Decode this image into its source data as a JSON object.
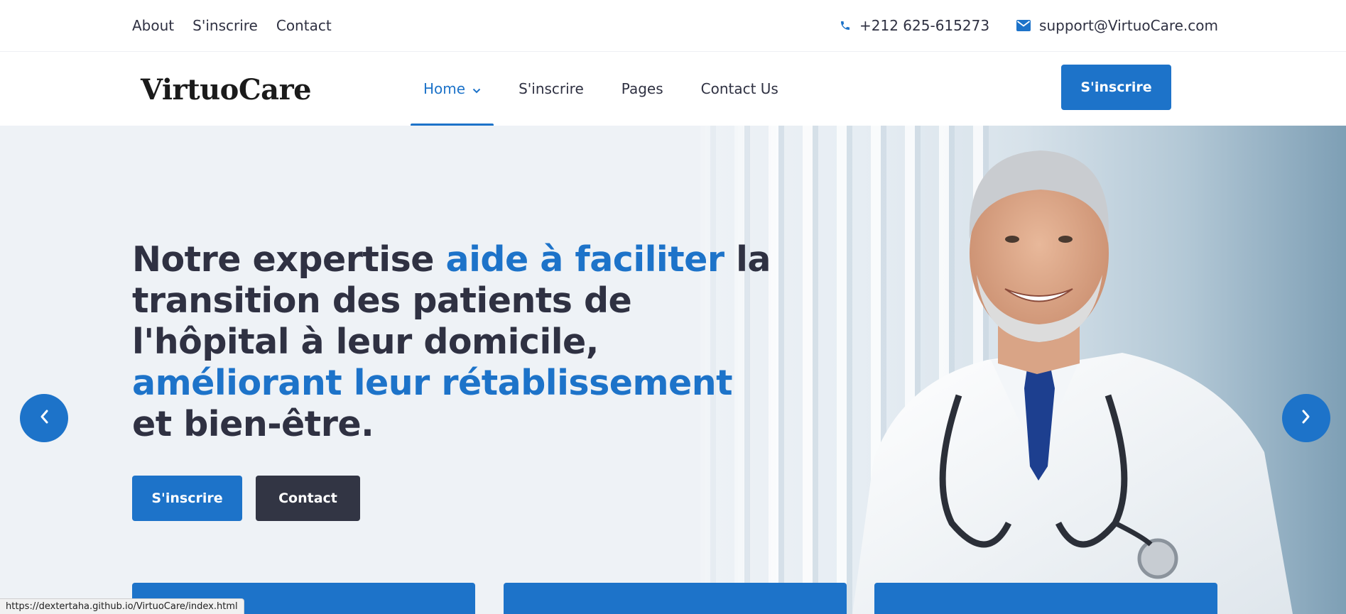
{
  "topbar": {
    "links": [
      "About",
      "S'inscrire",
      "Contact"
    ],
    "phone": "+212 625-615273",
    "email": "support@VirtuoCare.com",
    "phone_icon": "phone-icon",
    "email_icon": "envelope-icon"
  },
  "navbar": {
    "logo": "VirtuoCare",
    "menu": [
      {
        "label": "Home",
        "active": true,
        "dropdown": true
      },
      {
        "label": "S'inscrire"
      },
      {
        "label": "Pages"
      },
      {
        "label": "Contact Us"
      }
    ],
    "cta": "S'inscrire"
  },
  "hero": {
    "headline": {
      "part1": "Notre expertise ",
      "highlight1": "aide à faciliter",
      "part2": " la transition des patients de l'hôpital à leur domicile, ",
      "highlight2": "améliorant leur rétablissement",
      "part3": " et bien-être."
    },
    "primary_button": "S'inscrire",
    "secondary_button": "Contact",
    "prev_icon": "chevron-left-icon",
    "next_icon": "chevron-right-icon",
    "image": "smiling doctor with stethoscope"
  },
  "cards": [
    {},
    {},
    {}
  ],
  "status_bar": {
    "url": "https://dextertaha.github.io/VirtuoCare/index.html"
  },
  "colors": {
    "accent": "#1d73c9",
    "dark": "#323544",
    "text": "#2f3142"
  }
}
